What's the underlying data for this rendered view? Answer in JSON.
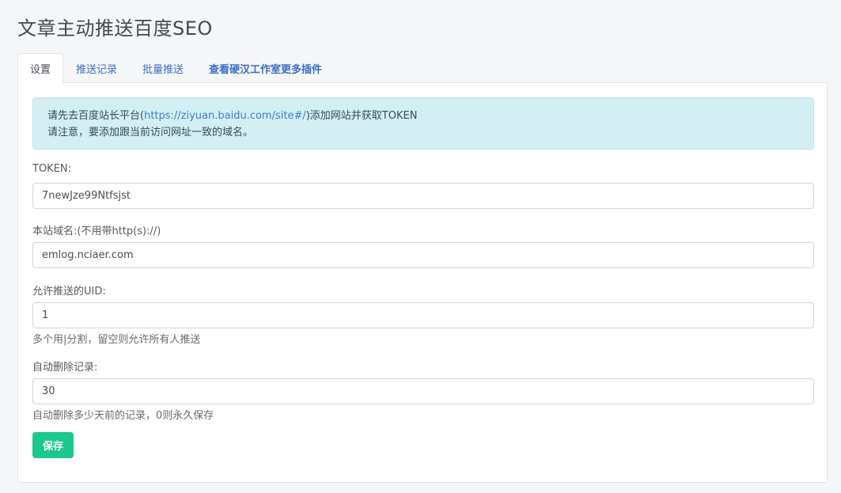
{
  "page_title": "文章主动推送百度SEO",
  "tabs": [
    {
      "label": "设置"
    },
    {
      "label": "推送记录"
    },
    {
      "label": "批量推送"
    },
    {
      "label": "查看硬汉工作室更多插件"
    }
  ],
  "notice": {
    "line1_prefix": "请先去百度站长平台(",
    "line1_link": "https://ziyuan.baidu.com/site#/",
    "line1_suffix": ")添加网站并获取TOKEN",
    "line2": "请注意，要添加跟当前访问网址一致的域名。"
  },
  "form": {
    "token_label": "TOKEN:",
    "token_value": "7newJze99Ntfsjst",
    "domain_label": "本站域名:(不用带http(s)://)",
    "domain_value": "emlog.nciaer.com",
    "uid_label": "允许推送的UID:",
    "uid_value": "1",
    "uid_help": "多个用|分割，留空则允许所有人推送",
    "delete_label": "自动删除记录:",
    "delete_value": "30",
    "delete_help": "自动删除多少天前的记录，0则永久保存",
    "save_label": "保存"
  },
  "colors": {
    "accent_link": "#3b6fc7",
    "save_button": "#1cc88f",
    "notice_bg": "#d4eff3"
  }
}
